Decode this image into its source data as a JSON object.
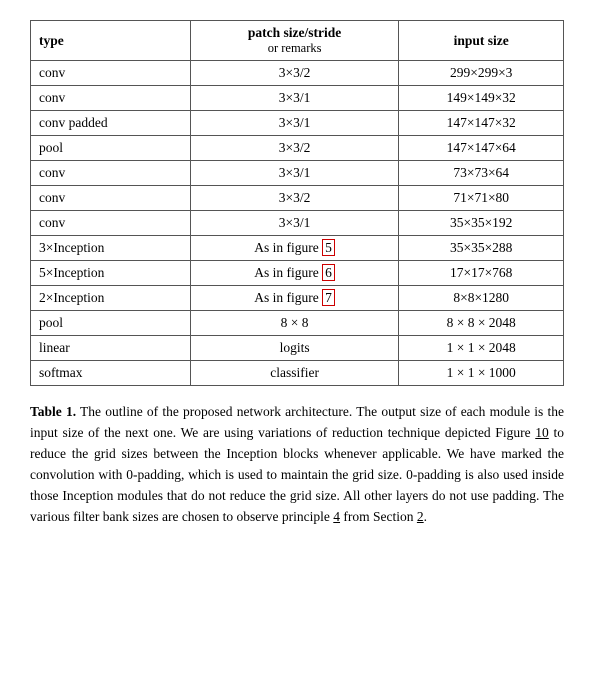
{
  "table": {
    "headers": [
      {
        "main": "type",
        "sub": ""
      },
      {
        "main": "patch size/stride",
        "sub": "or remarks"
      },
      {
        "main": "input size",
        "sub": ""
      }
    ],
    "rows": [
      {
        "type": "conv",
        "patch": "3×3/2",
        "input": "299×299×3"
      },
      {
        "type": "conv",
        "patch": "3×3/1",
        "input": "149×149×32"
      },
      {
        "type": "conv padded",
        "patch": "3×3/1",
        "input": "147×147×32"
      },
      {
        "type": "pool",
        "patch": "3×3/2",
        "input": "147×147×64"
      },
      {
        "type": "conv",
        "patch": "3×3/1",
        "input": "73×73×64"
      },
      {
        "type": "conv",
        "patch": "3×3/2",
        "input": "71×71×80"
      },
      {
        "type": "conv",
        "patch": "3×3/1",
        "input": "35×35×192"
      },
      {
        "type": "3×Inception",
        "patch": "As in figure 5",
        "input": "35×35×288",
        "highlight_patch": true
      },
      {
        "type": "5×Inception",
        "patch": "As in figure 6",
        "input": "17×17×768",
        "highlight_patch": true
      },
      {
        "type": "2×Inception",
        "patch": "As in figure 7",
        "input": "8×8×1280",
        "highlight_patch": true
      },
      {
        "type": "pool",
        "patch": "8 × 8",
        "input": "8 × 8 × 2048"
      },
      {
        "type": "linear",
        "patch": "logits",
        "input": "1 × 1 × 2048"
      },
      {
        "type": "softmax",
        "patch": "classifier",
        "input": "1 × 1 × 1000"
      }
    ]
  },
  "caption": {
    "label": "Table 1.",
    "text": " The outline of the proposed network architecture.  The output size of each module is the input size of the next one.  We are using variations of reduction technique depicted Figure ",
    "link1": "10",
    "text2": " to reduce the grid sizes between the Inception blocks whenever applicable.  We have marked the convolution with 0-padding, which is used to maintain the grid size.  0-padding is also used inside those Inception modules that do not reduce the grid size.  All other layers do not use padding.  The various filter bank sizes are chosen to observe principle ",
    "link2": "4",
    "text3": " from Section ",
    "link3": "2",
    "text4": "."
  }
}
